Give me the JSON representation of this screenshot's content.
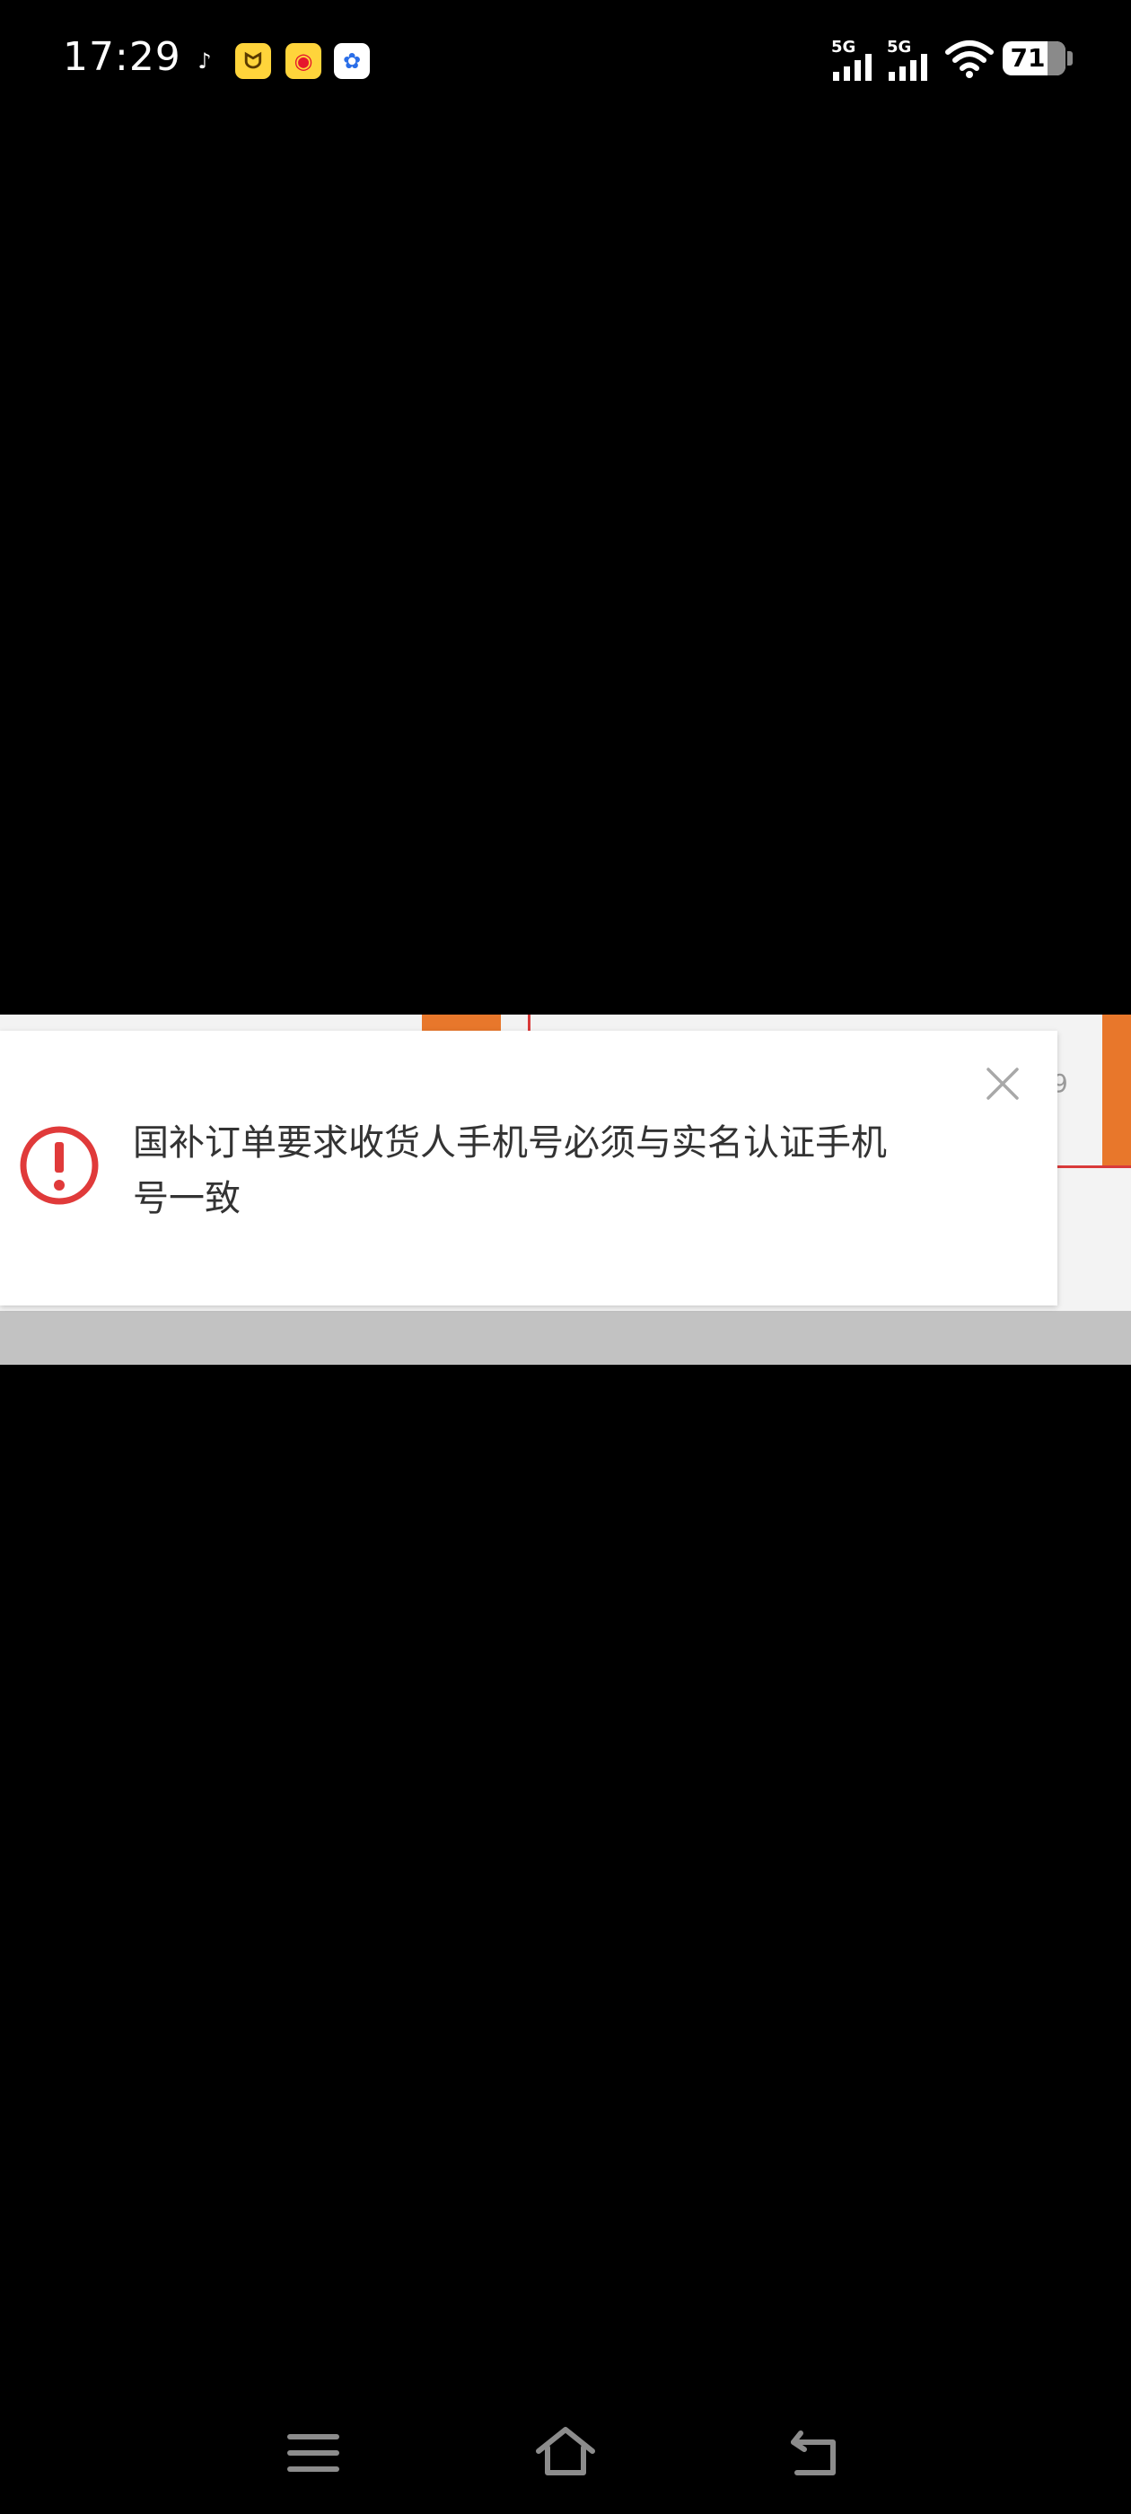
{
  "status_bar": {
    "time": "17:29",
    "notification_icons": [
      {
        "icon": "tiktok-icon",
        "glyph": "♪",
        "bg": "#000000",
        "color": "#ffffff"
      },
      {
        "icon": "bunny-app-icon",
        "glyph": "ᗢ",
        "bg": "#ffd43b",
        "color": "#5a3b00"
      },
      {
        "icon": "weibo-icon",
        "glyph": "◉",
        "bg": "#ffd43b",
        "color": "#e6162d"
      },
      {
        "icon": "baidu-icon",
        "glyph": "✿",
        "bg": "#ffffff",
        "color": "#2a6ee8"
      }
    ],
    "signal_1_label": "5G",
    "signal_2_label": "5G",
    "battery_level": "71",
    "battery_fraction": 0.71
  },
  "dialog": {
    "message": "国补订单要求收货人手机号必须与实名认证手机号一致",
    "alert_color": "#e03a3a",
    "close_icon": "close-icon"
  },
  "background": {
    "right_fragment": "9",
    "accent_orange": "#e8772b",
    "accent_red": "#d93a3a"
  },
  "nav_bar": {
    "buttons": [
      "menu-icon",
      "home-icon",
      "back-icon"
    ]
  }
}
